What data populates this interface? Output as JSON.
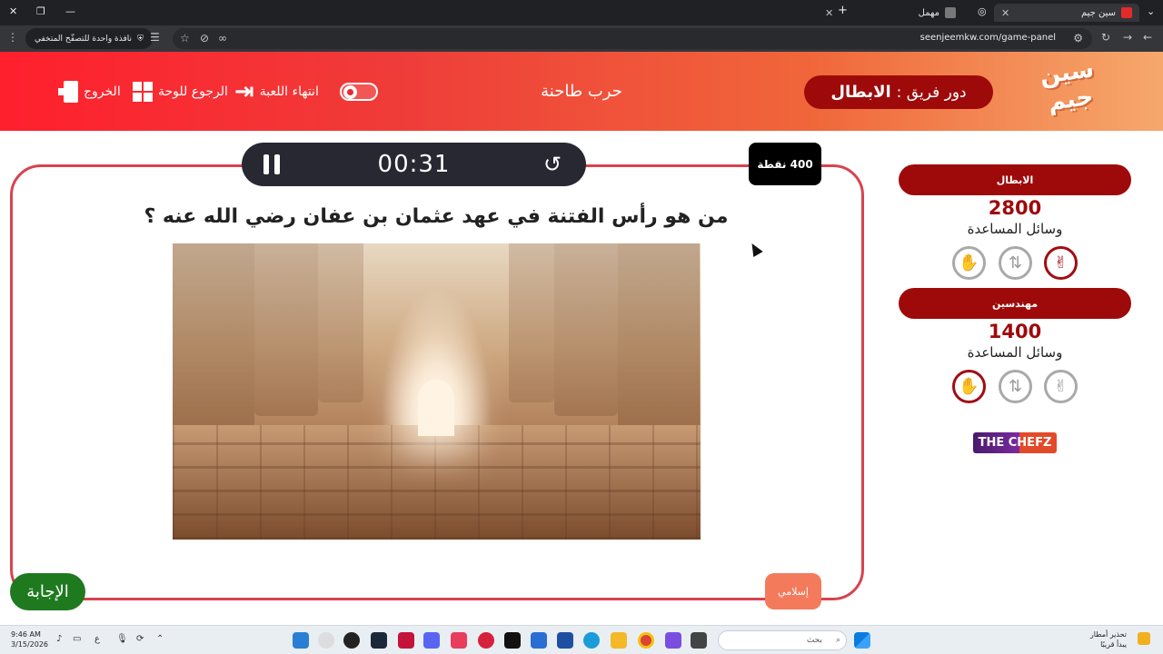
{
  "browser": {
    "tabs": [
      {
        "title": "سين جيم",
        "active": true
      },
      {
        "title": "مهمل",
        "active": false
      }
    ],
    "url": "seenjeemkw.com/game-panel",
    "incognito_label": "نافذة واحدة للتصفّح المتخفي"
  },
  "header": {
    "logo_text": "سين جيم",
    "turn_label": "دور فريق :",
    "turn_team": "الابطال",
    "category_title": "حرب طاحنة",
    "end_game_label": "انتهاء اللعبة",
    "back_to_board_label": "الرجوع للوحة",
    "exit_label": "الخروج"
  },
  "question": {
    "timer": "00:31",
    "points": "400 نقطة",
    "text": "من هو رأس الفتنة في عهد عثمان بن عفان رضي الله عنه ؟",
    "category_badge": "إسلامي",
    "answer_button": "الإجابة"
  },
  "teams": [
    {
      "name": "الابطال",
      "score": "2800",
      "aids_label": "وسائل المساعدة",
      "aids": [
        {
          "icon": "two-answers-icon",
          "glyph": "✌",
          "used": true
        },
        {
          "icon": "swap-icon",
          "glyph": "⇅",
          "used": false
        },
        {
          "icon": "hand-icon",
          "glyph": "✋",
          "used": false
        }
      ]
    },
    {
      "name": "مهندسين",
      "score": "1400",
      "aids_label": "وسائل المساعدة",
      "aids": [
        {
          "icon": "two-answers-icon",
          "glyph": "✌",
          "used": false
        },
        {
          "icon": "swap-icon",
          "glyph": "⇅",
          "used": false
        },
        {
          "icon": "hand-icon",
          "glyph": "✋",
          "used": true
        }
      ]
    }
  ],
  "sponsor": "THE CHEFZ",
  "taskbar": {
    "time": "9:46 AM",
    "date": "3/15/2026",
    "search_placeholder": "بحث",
    "weather_title": "تحذير أمطار",
    "weather_sub": "يبدأ قريبًا",
    "lang": "ع"
  },
  "colors": {
    "accent": "#9e0a0a",
    "panel_border": "#d8434f",
    "answer_green": "#1f7a1f",
    "badge_orange": "#f47a5c"
  }
}
